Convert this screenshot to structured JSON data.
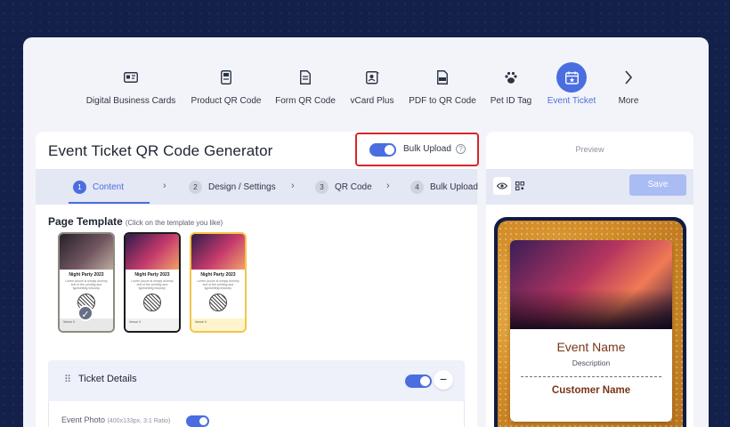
{
  "nav": {
    "items": [
      {
        "label": "Digital Business Cards",
        "icon": "id-card-icon"
      },
      {
        "label": "Product QR Code",
        "icon": "product-doc-icon"
      },
      {
        "label": "Form QR Code",
        "icon": "form-doc-icon"
      },
      {
        "label": "vCard Plus",
        "icon": "contact-card-icon"
      },
      {
        "label": "PDF to QR Code",
        "icon": "pdf-icon"
      },
      {
        "label": "Pet ID Tag",
        "icon": "paw-icon"
      },
      {
        "label": "Event Ticket",
        "icon": "calendar-star-icon",
        "active": true
      },
      {
        "label": "More",
        "icon": "chevron-right-icon"
      }
    ]
  },
  "header": {
    "title": "Event Ticket QR Code Generator",
    "bulk_upload_label": "Bulk Upload",
    "bulk_upload_on": true,
    "help_glyph": "?"
  },
  "steps": [
    {
      "num": "1",
      "label": "Content",
      "active": true
    },
    {
      "num": "2",
      "label": "Design / Settings"
    },
    {
      "num": "3",
      "label": "QR Code"
    },
    {
      "num": "4",
      "label": "Bulk Upload"
    }
  ],
  "template_section": {
    "title": "Page Template",
    "hint": "(Click on the template you like)",
    "templates": [
      {
        "title": "Night Party 2023",
        "subtitle": "Lorem Ipsum is simply dummy text of the printing and typesetting industry.",
        "venue": "Venue X",
        "selected": true
      },
      {
        "title": "Night Party 2023",
        "subtitle": "Lorem Ipsum is simply dummy text of the printing and typesetting industry.",
        "venue": "Venue X"
      },
      {
        "title": "Night Party 2023",
        "subtitle": "Lorem Ipsum is simply dummy text of the printing and typesetting industry.",
        "venue": "Venue X"
      }
    ]
  },
  "ticket_details": {
    "label": "Ticket Details",
    "enabled": true,
    "collapse_glyph": "−",
    "photo_label": "Event Photo",
    "photo_hint": "(400x133px, 3:1 Ratio)",
    "photo_enabled": true
  },
  "preview": {
    "label": "Preview",
    "save_label": "Save",
    "event_name": "Event Name",
    "description": "Description",
    "customer_name": "Customer Name"
  },
  "colors": {
    "accent": "#4a6ee0",
    "highlight_border": "#d9252b",
    "background": "#132049",
    "event_text": "#7a3518"
  }
}
